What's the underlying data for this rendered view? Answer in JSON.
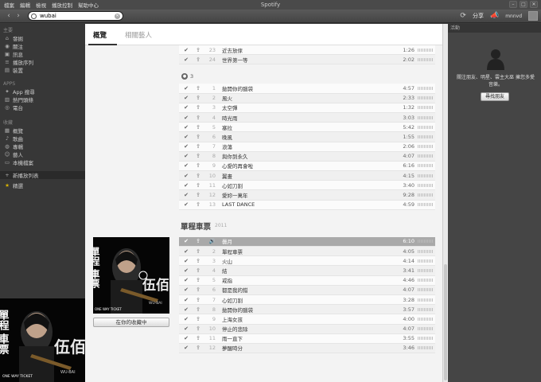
{
  "titlebar": {
    "menu": [
      "檔案",
      "編輯",
      "檢視",
      "播放控制",
      "幫助中心"
    ],
    "title": "Spotify"
  },
  "toolbar": {
    "search_value": "wubai",
    "share_label": "分享",
    "username": "mnnvd"
  },
  "sidebar": {
    "section_main": "主要",
    "main_items": [
      {
        "icon": "home-icon",
        "label": "發掘"
      },
      {
        "icon": "follow-icon",
        "label": "關注"
      },
      {
        "icon": "inbox-icon",
        "label": "訊息"
      },
      {
        "icon": "queue-icon",
        "label": "播放序列"
      },
      {
        "icon": "devices-icon",
        "label": "裝置"
      }
    ],
    "section_apps": "APPS",
    "app_items": [
      {
        "icon": "app-finder-icon",
        "label": "App 搜尋"
      },
      {
        "icon": "top-lists-icon",
        "label": "熱門頭條"
      },
      {
        "icon": "radio-icon",
        "label": "電台"
      }
    ],
    "section_collection": "收藏",
    "collection_items": [
      {
        "icon": "overview-icon",
        "label": "概覽"
      },
      {
        "icon": "songs-icon",
        "label": "歌曲"
      },
      {
        "icon": "albums-icon",
        "label": "專輯"
      },
      {
        "icon": "artists-icon",
        "label": "藝人"
      },
      {
        "icon": "local-files-icon",
        "label": "本機檔案"
      }
    ],
    "new_playlist": "新播放列表",
    "starred": "精選"
  },
  "main": {
    "tabs": [
      "概覽",
      "相關藝人"
    ],
    "album1_tail": [
      {
        "n": "23",
        "title": "近去放傢",
        "dur": "1:26"
      },
      {
        "n": "24",
        "title": "世界第一等",
        "dur": "2:02"
      }
    ],
    "disc_label": "3",
    "disc3_tracks": [
      {
        "n": "1",
        "title": "拋開你的腦袋",
        "dur": "4:57"
      },
      {
        "n": "2",
        "title": "風火",
        "dur": "2:33"
      },
      {
        "n": "3",
        "title": "太空彈",
        "dur": "1:32"
      },
      {
        "n": "4",
        "title": "時光雨",
        "dur": "3:03"
      },
      {
        "n": "5",
        "title": "塞拉",
        "dur": "5:42"
      },
      {
        "n": "6",
        "title": "晚風",
        "dur": "1:55"
      },
      {
        "n": "7",
        "title": "浪蕩",
        "dur": "2:06"
      },
      {
        "n": "8",
        "title": "與你到永久",
        "dur": "4:07"
      },
      {
        "n": "9",
        "title": "心愛的再會啦",
        "dur": "6:16"
      },
      {
        "n": "10",
        "title": "翼畫",
        "dur": "4:15"
      },
      {
        "n": "11",
        "title": "心如刀割",
        "dur": "3:40"
      },
      {
        "n": "12",
        "title": "愛妳一萬年",
        "dur": "9:28"
      },
      {
        "n": "13",
        "title": "LAST DANCE",
        "dur": "4:59"
      }
    ],
    "album2": {
      "title": "單程車票",
      "year": "2011",
      "cover_title": "單程車票",
      "cover_artist": "伍佰",
      "cover_sub1": "WU-BAI",
      "cover_sub2": "ONE WAY TICKET",
      "collection_button": "在你的收藏中",
      "tracks": [
        {
          "n": "1",
          "title": "曇月",
          "dur": "6:10",
          "playing": true
        },
        {
          "n": "2",
          "title": "單程車票",
          "dur": "4:05"
        },
        {
          "n": "3",
          "title": "火山",
          "dur": "4:14"
        },
        {
          "n": "4",
          "title": "結",
          "dur": "3:41"
        },
        {
          "n": "5",
          "title": "戒指",
          "dur": "4:46"
        },
        {
          "n": "6",
          "title": "都是我的錯",
          "dur": "4:07"
        },
        {
          "n": "7",
          "title": "心如刀割",
          "dur": "3:28"
        },
        {
          "n": "8",
          "title": "拋開你的腦袋",
          "dur": "3:57"
        },
        {
          "n": "9",
          "title": "上海女孩",
          "dur": "4:00"
        },
        {
          "n": "10",
          "title": "停止的悲除",
          "dur": "4:07"
        },
        {
          "n": "11",
          "title": "雨一直下",
          "dur": "3:55"
        },
        {
          "n": "12",
          "title": "夢醒時分",
          "dur": "3:46"
        }
      ]
    }
  },
  "activity": {
    "header": "活動",
    "message": "關注朋友、明星、雲主大巫 擁您多愛音樂。",
    "find_friends": "尋找朋友"
  },
  "colors": {
    "sidebar_bg": "#373737",
    "main_bg": "#f3f3f3",
    "playing_row": "#a9a9a9",
    "starred": "#d8b300"
  }
}
